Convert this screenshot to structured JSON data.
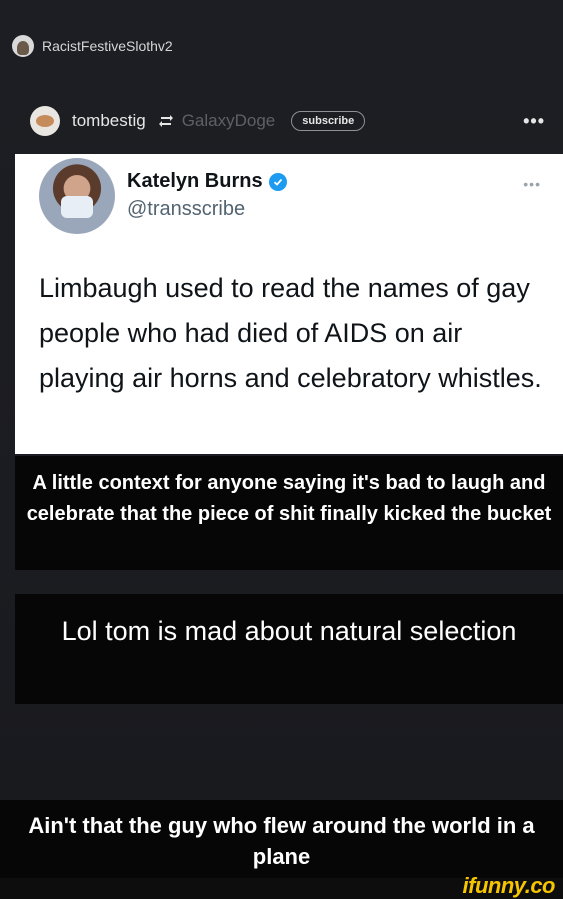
{
  "poster": {
    "username": "RacistFestiveSlothv2",
    "avatar_icon": "sloth-avatar-icon"
  },
  "repost": {
    "username": "tombestig",
    "repost_icon": "repost-icon",
    "original_poster": "GalaxyDoge",
    "subscribe_label": "subscribe",
    "more_label": "•••"
  },
  "tweet": {
    "display_name": "Katelyn Burns",
    "verified": true,
    "handle": "@transscribe",
    "more_label": "•••",
    "text": "Limbaugh used to read the names of gay people who had died of AIDS on air playing air horns and celebratory whistles."
  },
  "captions": {
    "first": "A little context for anyone saying it's bad to laugh and celebrate that the piece of shit finally kicked the bucket",
    "second": "Lol tom is mad about natural selection",
    "third": "Ain't that the guy who flew around the world in a plane"
  },
  "watermark": "ifunny.co",
  "colors": {
    "verified": "#1d9bf0",
    "watermark": "#f5c500",
    "background": "#1c1d22"
  }
}
